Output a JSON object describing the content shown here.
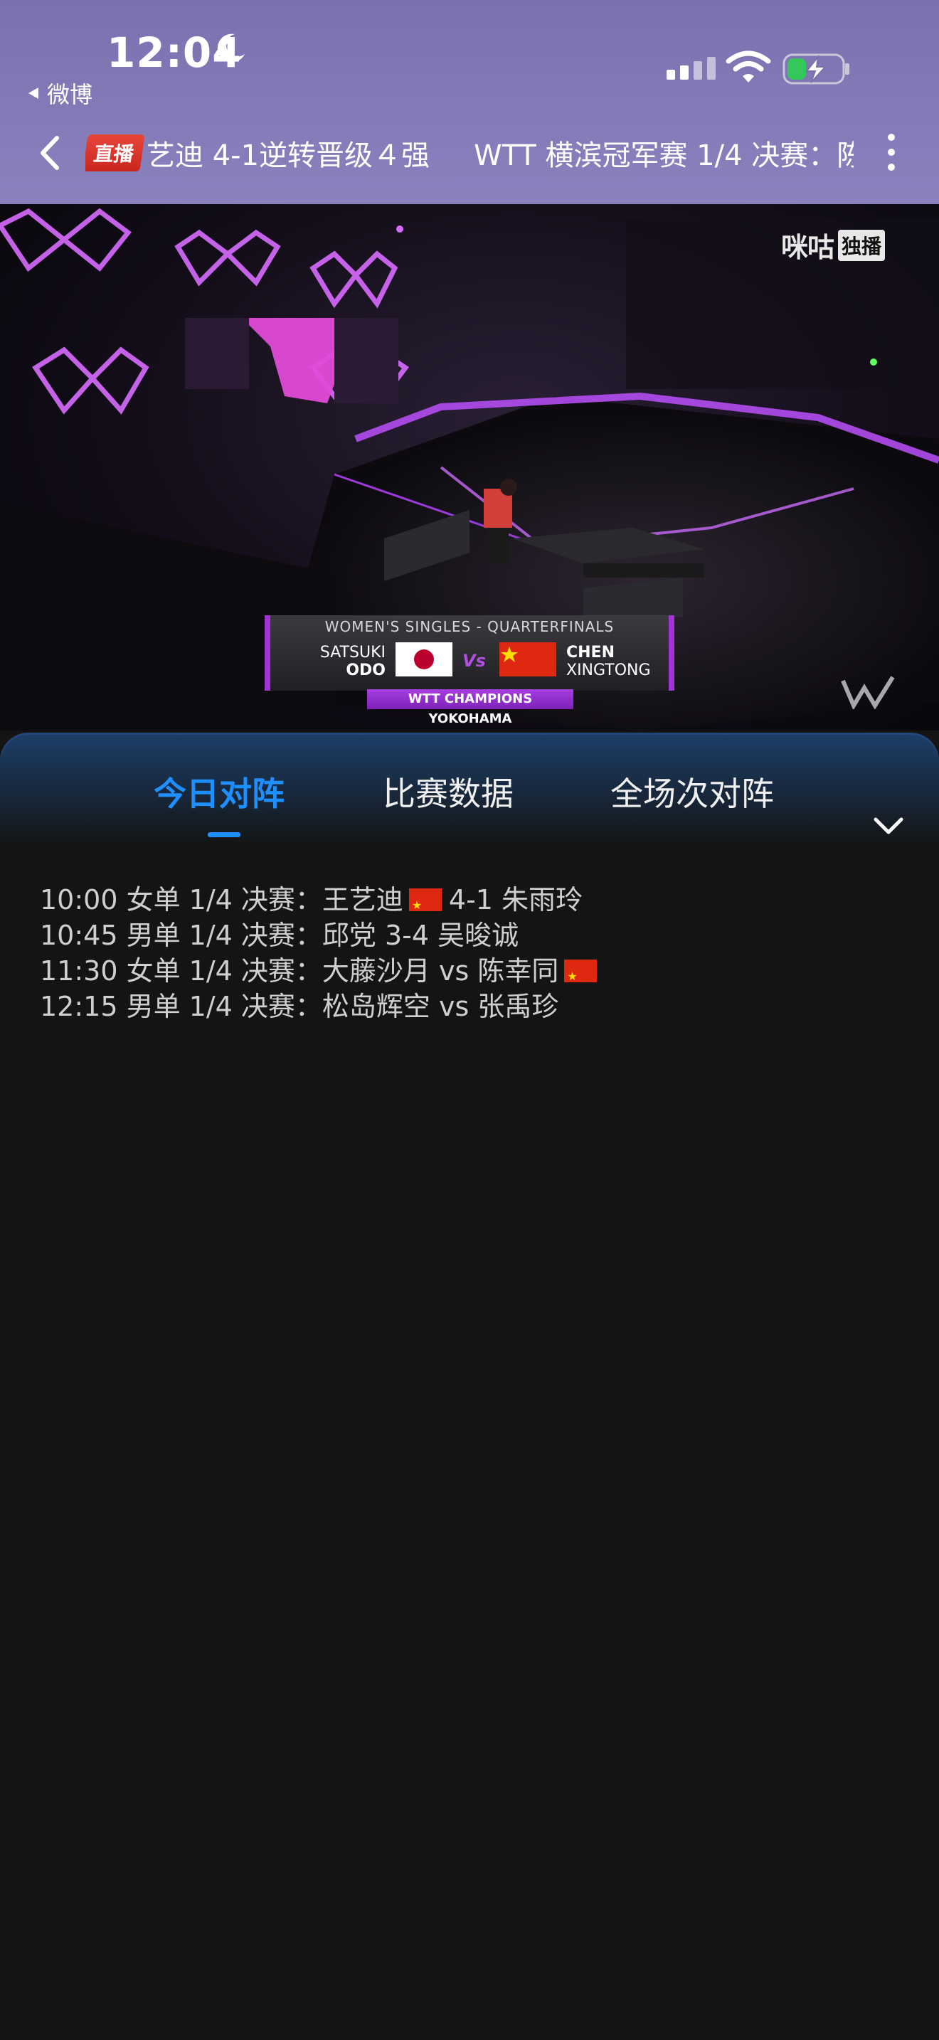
{
  "status_bar": {
    "time": "12:04",
    "back_app": "微博"
  },
  "nav": {
    "live_badge": "直播",
    "ticker_text": "艺迪 4-1逆转晋级４强",
    "ticker_text2": "WTT 横滨冠军赛 1/4 决赛：陈"
  },
  "video": {
    "watermark_name": "咪咕",
    "watermark_tag": "独播",
    "scoreboard": {
      "title": "WOMEN'S SINGLES - QUARTERFINALS",
      "player1_first": "SATSUKI",
      "player1_last": "ODO",
      "vs": "Vs",
      "player2_last": "CHEN",
      "player2_first": "XINGTONG",
      "event": "WTT CHAMPIONS YOKOHAMA"
    }
  },
  "tabs": [
    {
      "label": "今日对阵"
    },
    {
      "label": "比赛数据"
    },
    {
      "label": "全场次对阵"
    }
  ],
  "schedule": [
    {
      "before": "10:00 女单 1/4 决赛：王艺迪",
      "flag1": true,
      "after": "4-1 朱雨玲",
      "flag2": false
    },
    {
      "before": "10:45 男单 1/4 决赛：邱党 3-4 吴晙诚",
      "flag1": false,
      "after": "",
      "flag2": false
    },
    {
      "before": "11:30 女单 1/4 决赛：大藤沙月 vs 陈幸同",
      "flag1": false,
      "after": "",
      "flag2": true
    },
    {
      "before": "12:15 男单 1/4 决赛：松岛辉空 vs 张禹珍",
      "flag1": false,
      "after": "",
      "flag2": false
    }
  ],
  "colors": {
    "header_bg": "#8078b6",
    "accent_blue": "#1e8fff",
    "panel_bg": "#141414",
    "live_red": "#d9332a",
    "scoreboard_purple": "#a234d6"
  },
  "icons": [
    "moon-icon",
    "cellular-signal-icon",
    "wifi-icon",
    "battery-charging-icon",
    "back-arrow-icon",
    "more-vertical-icon",
    "chevron-down-icon"
  ]
}
